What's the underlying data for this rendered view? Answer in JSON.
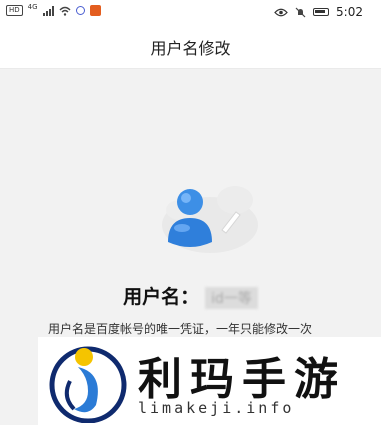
{
  "status_bar": {
    "left_indicators": [
      "HD",
      "4G"
    ],
    "time": "5:02",
    "icons": [
      "signal-icon",
      "wifi-icon",
      "app-notification-icon",
      "eye-icon",
      "mute-icon",
      "battery-icon"
    ]
  },
  "header": {
    "title": "用户名修改"
  },
  "profile": {
    "label": "用户名：",
    "value_masked": "id一等"
  },
  "description": "用户名是百度帐号的唯一凭证，一年只能修改一次",
  "watermark": {
    "title": "利玛手游",
    "subtitle": "limakeji.info"
  },
  "colors": {
    "accent_blue": "#3a8ee6",
    "logo_yellow": "#f5c400",
    "logo_navy": "#0f2a6e"
  }
}
